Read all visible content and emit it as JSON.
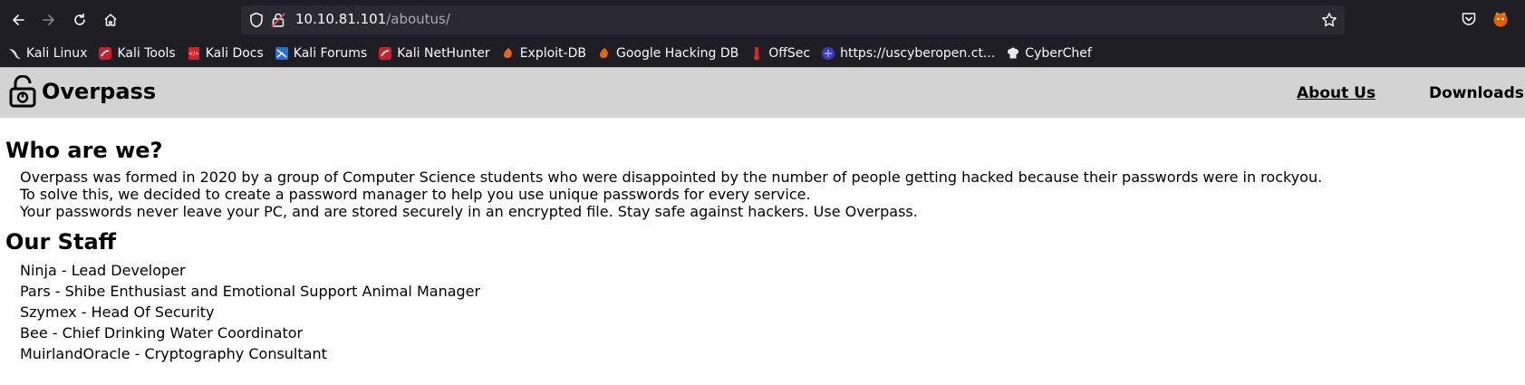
{
  "browser": {
    "url_host": "10.10.81.101",
    "url_path": "/aboutus/",
    "bookmarks": [
      {
        "label": "Kali Linux",
        "icon": "kali-dragon-icon"
      },
      {
        "label": "Kali Tools",
        "icon": "kali-tools-icon"
      },
      {
        "label": "Kali Docs",
        "icon": "kali-docs-icon"
      },
      {
        "label": "Kali Forums",
        "icon": "kali-forums-icon"
      },
      {
        "label": "Kali NetHunter",
        "icon": "kali-nethunter-icon"
      },
      {
        "label": "Exploit-DB",
        "icon": "exploit-db-icon"
      },
      {
        "label": "Google Hacking DB",
        "icon": "ghdb-icon"
      },
      {
        "label": "OffSec",
        "icon": "offsec-icon"
      },
      {
        "label": "https://uscyberopen.ct...",
        "icon": "uscyberopen-icon"
      },
      {
        "label": "CyberChef",
        "icon": "cyberchef-icon"
      }
    ]
  },
  "site": {
    "title": "Overpass",
    "nav": [
      "About Us",
      "Downloads"
    ]
  },
  "about": {
    "heading": "Who are we?",
    "lines": [
      "Overpass was formed in 2020 by a group of Computer Science students who were disappointed by the number of people getting hacked because their passwords were in rockyou.",
      "To solve this, we decided to create a password manager to help you use unique passwords for every service.",
      "Your passwords never leave your PC, and are stored securely in an encrypted file. Stay safe against hackers. Use Overpass."
    ]
  },
  "staff": {
    "heading": "Our Staff",
    "members": [
      "Ninja - Lead Developer",
      "Pars - Shibe Enthusiast and Emotional Support Animal Manager",
      "Szymex - Head Of Security",
      "Bee - Chief Drinking Water Coordinator",
      "MuirlandOracle - Cryptography Consultant"
    ]
  }
}
